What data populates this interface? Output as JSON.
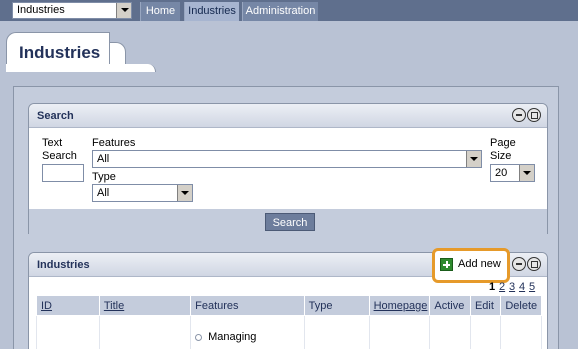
{
  "topnav": {
    "selector_value": "Industries",
    "tabs": [
      "Home",
      "Industries",
      "Administration"
    ]
  },
  "page": {
    "tab_title": "Industries"
  },
  "search_panel": {
    "title": "Search",
    "text_search_label_line1": "Text",
    "text_search_label_line2": "Search",
    "features_label": "Features",
    "features_value": "All",
    "type_label": "Type",
    "type_value": "All",
    "page_size_label_line1": "Page",
    "page_size_label_line2": "Size",
    "page_size_value": "20",
    "search_button": "Search"
  },
  "industries_panel": {
    "title": "Industries",
    "add_new": "Add new",
    "pages": [
      "1",
      "2",
      "3",
      "4",
      "5"
    ],
    "columns": [
      "ID",
      "Title",
      "Features",
      "Type",
      "Homepage",
      "Active",
      "Edit",
      "Delete"
    ],
    "first_row_feature": "Managing"
  },
  "colors": {
    "accent": "#e69a2a",
    "nav_bg": "#5f6f8d",
    "button_bg": "#6d7d9c"
  }
}
